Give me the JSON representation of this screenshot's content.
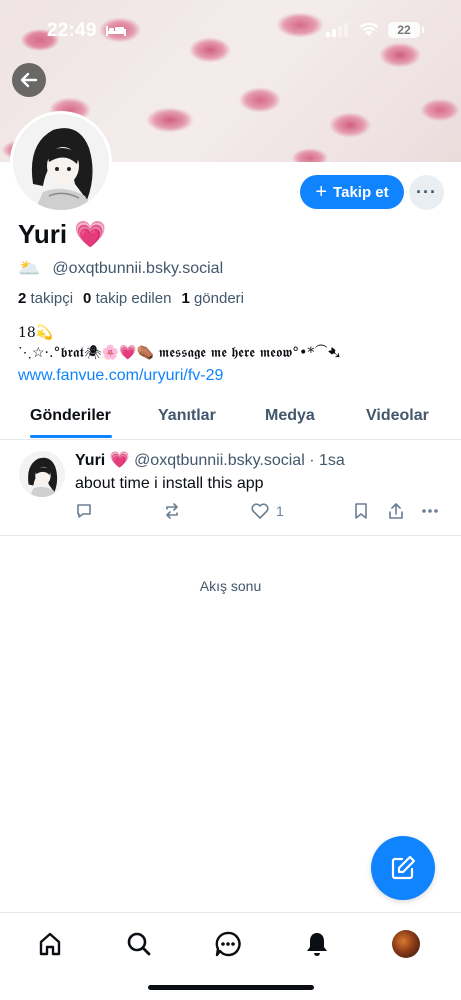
{
  "status_bar": {
    "time": "22:49",
    "battery": "22"
  },
  "profile": {
    "display_name": "Yuri 💗",
    "handle_emoji": "🌥️",
    "handle": "@oxqtbunnii.bsky.social",
    "stats": {
      "followers_count": "2",
      "followers_label": "takipçi",
      "following_count": "0",
      "following_label": "takip edilen",
      "posts_count": "1",
      "posts_label": "gönderi"
    },
    "bio_line1": "18💫",
    "bio_line2": "⋱☆·.°𝖇𝖗𝖆𝖙🕷🌸💗⚰️ 𝖒𝖊𝖘𝖘𝖆𝖌𝖊 𝖒𝖊 𝖍𝖊𝖗𝖊 𝖒𝖊𝖔𝖜°•*⁀➷",
    "link": "www.fanvue.com/uryuri/fv-29"
  },
  "buttons": {
    "follow_label": "Takip et",
    "more_label": "···"
  },
  "tabs": [
    {
      "label": "Gönderiler",
      "active": true
    },
    {
      "label": "Yanıtlar",
      "active": false
    },
    {
      "label": "Medya",
      "active": false
    },
    {
      "label": "Videolar",
      "active": false
    }
  ],
  "post": {
    "author": "Yuri 💗",
    "handle": "@oxqtbunnii.bsky.social",
    "time": "· 1sa",
    "text": "about time i install this app",
    "likes": "1"
  },
  "feed_end": "Akış sonu",
  "colors": {
    "accent": "#1083fe",
    "muted": "#42576c",
    "text": "#0b0f14"
  },
  "icons": {
    "status": [
      "bed-icon",
      "signal-icon",
      "wifi-icon",
      "battery-icon"
    ],
    "nav": [
      "home-icon",
      "search-icon",
      "chat-icon",
      "bell-icon",
      "profile-avatar"
    ],
    "post_actions": [
      "reply-icon",
      "repost-icon",
      "heart-icon",
      "bookmark-icon",
      "share-icon",
      "more-icon"
    ],
    "fab": "compose-icon"
  }
}
